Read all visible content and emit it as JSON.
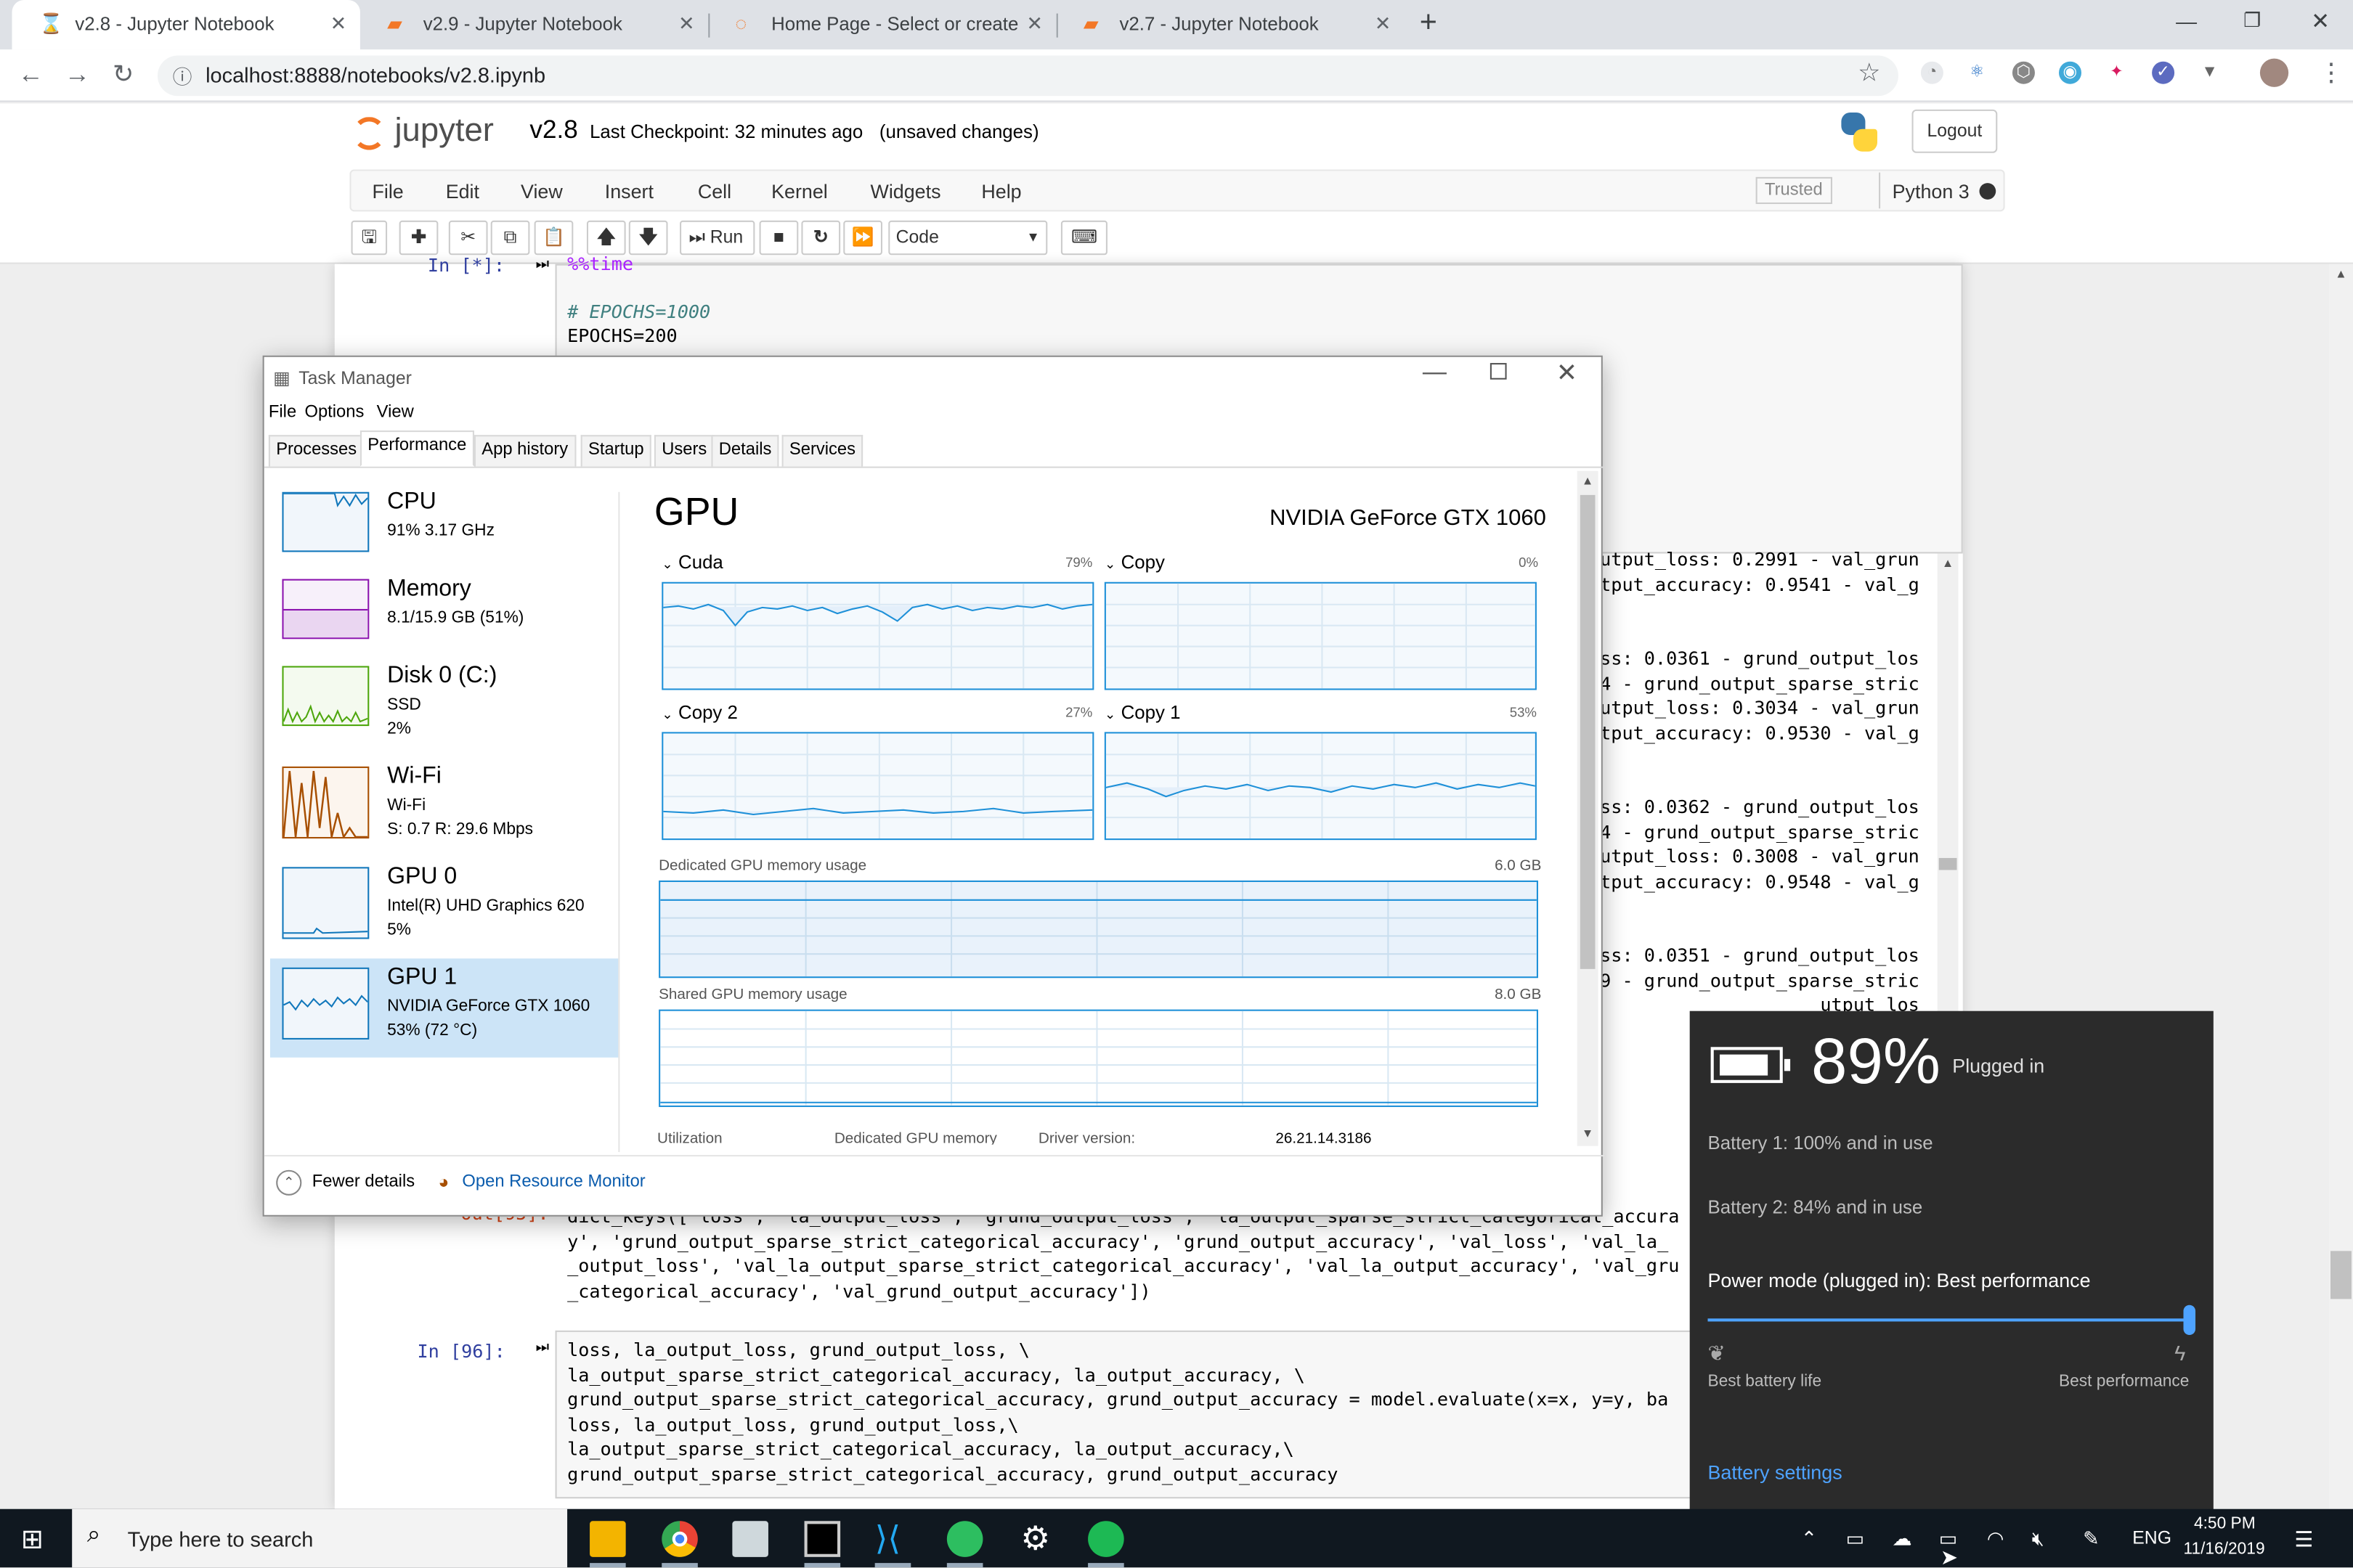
{
  "browser": {
    "tabs": [
      {
        "title": "v2.8 - Jupyter Notebook",
        "active": true
      },
      {
        "title": "v2.9 - Jupyter Notebook",
        "active": false
      },
      {
        "title": "Home Page - Select or create a n",
        "active": false
      },
      {
        "title": "v2.7 - Jupyter Notebook",
        "active": false
      }
    ],
    "new_tab": "+",
    "url": "localhost:8888/notebooks/v2.8.ipynb"
  },
  "jupyter": {
    "logo_text": "jupyter",
    "notebook_name": "v2.8",
    "checkpoint": "Last Checkpoint: 32 minutes ago",
    "unsaved": "(unsaved changes)",
    "logout": "Logout",
    "menu": [
      "File",
      "Edit",
      "View",
      "Insert",
      "Cell",
      "Kernel",
      "Widgets",
      "Help"
    ],
    "trusted": "Trusted",
    "kernel": "Python 3",
    "run_label": "Run",
    "cell_type": "Code"
  },
  "cells": {
    "top_prompt": "In [*]:",
    "top_lines": [
      "%%time",
      "",
      "# EPOCHS=1000",
      "EPOCHS=200"
    ],
    "output_lines": [
      "utput_loss: 0.2991 - val_grun",
      "tput_accuracy: 0.9541 - val_g",
      "",
      "",
      "ss: 0.0361 - grund_output_los",
      "4 - grund_output_sparse_stric",
      "utput_loss: 0.3034 - val_grun",
      "tput_accuracy: 0.9530 - val_g",
      "",
      "",
      "ss: 0.0362 - grund_output_los",
      "4 - grund_output_sparse_stric",
      "utput_loss: 0.3008 - val_grun",
      "tput_accuracy: 0.9548 - val_g",
      "",
      "",
      "ss: 0.0351 - grund_output_los",
      "9 - grund_output_sparse_stric",
      "utput_los"
    ],
    "out_prompt": "Out[95]:",
    "out_lines": [
      "dict_keys(['loss', 'la_output_loss', 'grund_output_loss', 'la_output_sparse_strict_categorical_accura",
      "y', 'grund_output_sparse_strict_categorical_accuracy', 'grund_output_accuracy', 'val_loss', 'val_la_",
      "_output_loss', 'val_la_output_sparse_strict_categorical_accuracy', 'val_la_output_accuracy', 'val_gru",
      "_categorical_accuracy', 'val_grund_output_accuracy'])"
    ],
    "in96_prompt": "In [96]:",
    "in96_lines": [
      "loss, la_output_loss, grund_output_loss, \\",
      "la_output_sparse_strict_categorical_accuracy, la_output_accuracy, \\",
      "grund_output_sparse_strict_categorical_accuracy, grund_output_accuracy = model.evaluate(x=x, y=y, ba",
      "loss, la_output_loss, grund_output_loss,\\",
      "la_output_sparse_strict_categorical_accuracy, la_output_accuracy,\\",
      "grund_output_sparse_strict_categorical_accuracy, grund_output_accuracy"
    ]
  },
  "task_manager": {
    "title": "Task Manager",
    "menu": [
      "File",
      "Options",
      "View"
    ],
    "tabs": [
      "Processes",
      "Performance",
      "App history",
      "Startup",
      "Users",
      "Details",
      "Services"
    ],
    "sidebar": [
      {
        "name": "CPU",
        "l1": "91%  3.17 GHz",
        "l2": "",
        "l3": "",
        "color": "#1177bb"
      },
      {
        "name": "Memory",
        "l1": "8.1/15.9 GB (51%)",
        "l2": "",
        "l3": "",
        "color": "#8b12ae"
      },
      {
        "name": "Disk 0 (C:)",
        "l1": "SSD",
        "l2": "2%",
        "l3": "",
        "color": "#4da60c"
      },
      {
        "name": "Wi-Fi",
        "l1": "Wi-Fi",
        "l2": "S: 0.7  R: 29.6 Mbps",
        "l3": "",
        "color": "#a74f01"
      },
      {
        "name": "GPU 0",
        "l1": "Intel(R) UHD Graphics 620",
        "l2": "5%",
        "l3": "",
        "color": "#1177bb"
      },
      {
        "name": "GPU 1",
        "l1": "NVIDIA GeForce GTX 1060",
        "l2": "53% (72 °C)",
        "l3": "",
        "color": "#1177bb"
      }
    ],
    "gpu_heading": "GPU",
    "gpu_model": "NVIDIA GeForce GTX 1060",
    "engines": [
      {
        "name": "Cuda",
        "pct": "79%"
      },
      {
        "name": "Copy",
        "pct": "0%"
      },
      {
        "name": "Copy 2",
        "pct": "27%"
      },
      {
        "name": "Copy 1",
        "pct": "53%"
      }
    ],
    "dedicated_label": "Dedicated GPU memory usage",
    "dedicated_max": "6.0 GB",
    "shared_label": "Shared GPU memory usage",
    "shared_max": "8.0 GB",
    "footer_cols": [
      "Utilization",
      "Dedicated GPU memory",
      "Driver version:",
      "26.21.14.3186"
    ],
    "fewer_details": "Fewer details",
    "resource_monitor": "Open Resource Monitor"
  },
  "battery": {
    "percent": "89%",
    "status": "Plugged in",
    "battery1": "Battery 1: 100% and in use",
    "battery2": "Battery 2: 84% and in use",
    "power_mode": "Power mode (plugged in): Best performance",
    "slider_level": 1.0,
    "left_label": "Best battery life",
    "right_label": "Best performance",
    "settings_link": "Battery settings"
  },
  "taskbar": {
    "search_placeholder": "Type here to search",
    "lang": "ENG",
    "time": "4:50 PM",
    "date": "11/16/2019"
  },
  "colors": {
    "jupyter_orange": "#f37726",
    "tm_accent": "#1e90d8",
    "flyout_bg": "#2b2b2b",
    "link_blue": "#4ea3ff",
    "taskbar_bg": "#101820"
  }
}
